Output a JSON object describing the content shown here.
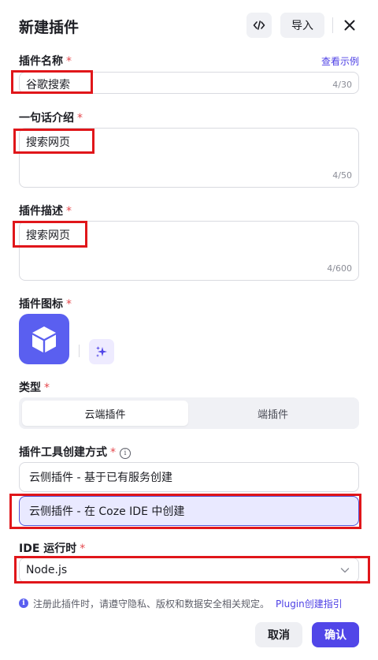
{
  "dialog": {
    "title": "新建插件",
    "import_label": "导入",
    "icons": {
      "code": "code-icon",
      "close": "close-icon"
    }
  },
  "plugin_name": {
    "label": "插件名称",
    "required_mark": "*",
    "example_link": "查看示例",
    "value": "谷歌搜索",
    "counter": "4/30"
  },
  "intro": {
    "label": "一句话介绍",
    "required_mark": "*",
    "value": "搜索网页",
    "counter": "4/50"
  },
  "description": {
    "label": "插件描述",
    "required_mark": "*",
    "value": "搜索网页",
    "counter": "4/600"
  },
  "plugin_icon": {
    "label": "插件图标",
    "required_mark": "*",
    "icon": "cube-icon",
    "ai_icon": "sparkle-icon"
  },
  "type": {
    "label": "类型",
    "required_mark": "*",
    "options": [
      "云端插件",
      "端插件"
    ],
    "selected": "云端插件"
  },
  "creation_method": {
    "label": "插件工具创建方式",
    "required_mark": "*",
    "info_glyph": "i",
    "options": [
      "云侧插件 - 基于已有服务创建",
      "云侧插件 - 在 Coze IDE 中创建"
    ],
    "selected": "云侧插件 - 在 Coze IDE 中创建"
  },
  "ide_runtime": {
    "label": "IDE 运行时",
    "required_mark": "*",
    "value": "Node.js"
  },
  "notice": {
    "glyph": "i",
    "text": "注册此插件时，请遵守隐私、版权和数据安全相关规定。",
    "link": "Plugin创建指引"
  },
  "footer": {
    "cancel_label": "取消",
    "confirm_label": "确认"
  },
  "colors": {
    "accent": "#5146e8",
    "highlight": "#e0161a",
    "required": "#e5484d"
  }
}
